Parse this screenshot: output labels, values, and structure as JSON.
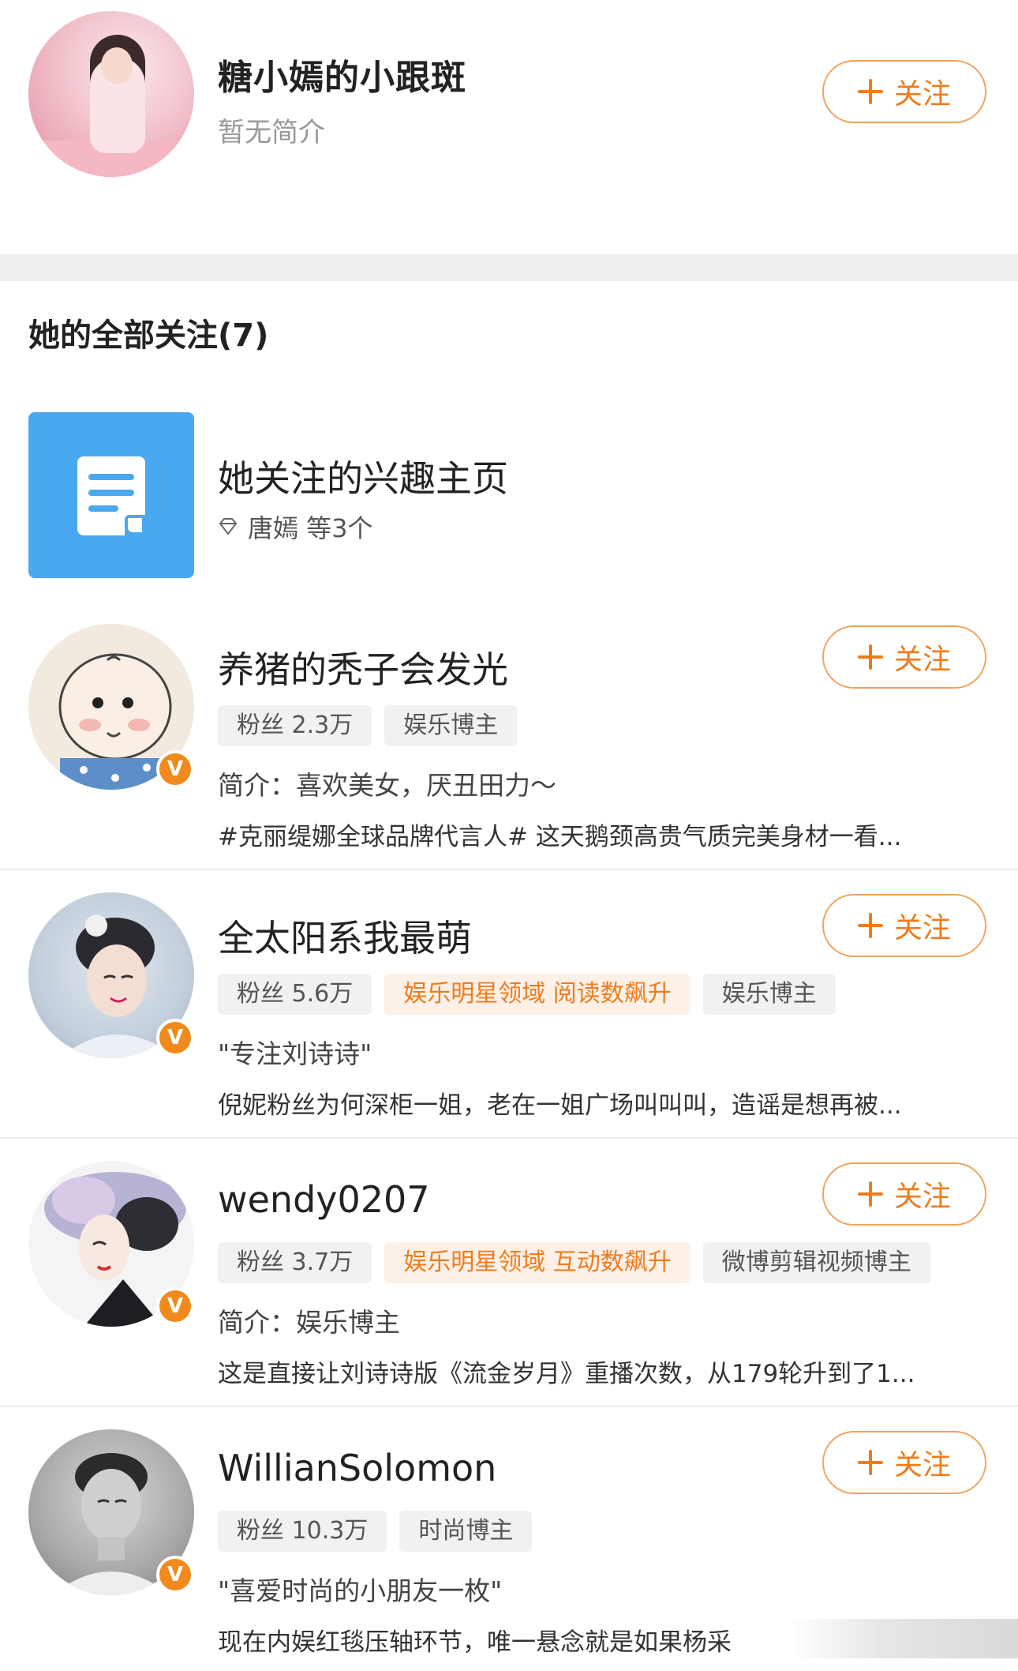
{
  "profile": {
    "name": "糖小嫣的小跟斑",
    "bio": "暂无简介",
    "follow_label": "关注"
  },
  "section": {
    "title": "她的全部关注(7)"
  },
  "interest": {
    "title": "她关注的兴趣主页",
    "sub": "唐嫣 等3个"
  },
  "users": [
    {
      "name": "养猪的秃子会发光",
      "fans": "粉丝 2.3万",
      "tags": [
        "娱乐博主"
      ],
      "bio": "简介：喜欢美女，厌丑田力～",
      "post": "#克丽缇娜全球品牌代言人# 这天鹅颈高贵气质完美身材一看...",
      "follow_label": "关注",
      "verified": "V"
    },
    {
      "name": "全太阳系我最萌",
      "fans": "粉丝 5.6万",
      "hot_tag": "娱乐明星领域 阅读数飙升",
      "tags": [
        "娱乐博主"
      ],
      "bio": "\"专注刘诗诗\"",
      "post": "倪妮粉丝为何深柜一姐，老在一姐广场叫叫叫，造谣是想再被...",
      "follow_label": "关注",
      "verified": "V"
    },
    {
      "name": "wendy0207",
      "fans": "粉丝 3.7万",
      "hot_tag": "娱乐明星领域 互动数飙升",
      "tags": [
        "微博剪辑视频博主"
      ],
      "bio": "简介：娱乐博主",
      "post": "这是直接让刘诗诗版《流金岁月》重播次数，从179轮升到了1...",
      "follow_label": "关注",
      "verified": "V"
    },
    {
      "name": "WillianSolomon",
      "fans": "粉丝 10.3万",
      "tags": [
        "时尚博主"
      ],
      "bio": "\"喜爱时尚的小朋友一枚\"",
      "post": "现在内娱红毯压轴环节，唯一悬念就是如果杨采",
      "follow_label": "关注",
      "verified": "V"
    }
  ]
}
